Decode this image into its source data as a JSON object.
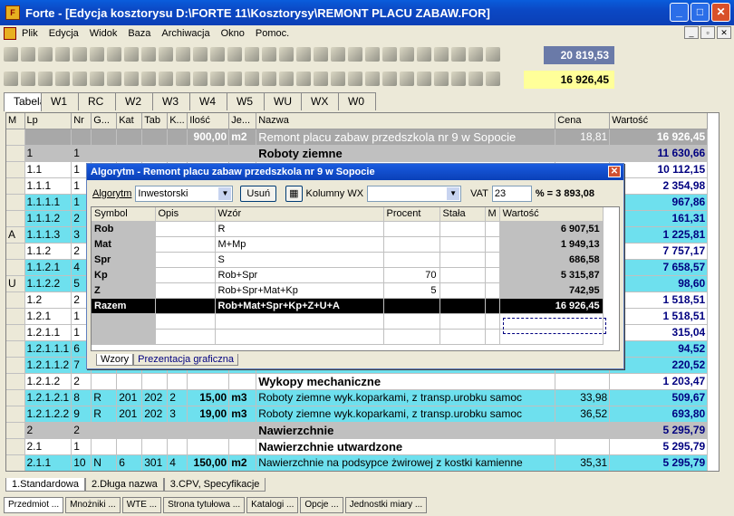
{
  "window": {
    "title": "Forte - [Edycja kosztorysu D:\\FORTE 11\\Kosztorysy\\REMONT PLACU ZABAW.FOR]",
    "menu": [
      "Plik",
      "Edycja",
      "Widok",
      "Baza",
      "Archiwacja",
      "Okno",
      "Pomoc."
    ]
  },
  "toolbar": {
    "value1": "20 819,53",
    "value2": "16 926,45"
  },
  "tabs": [
    "Tabela",
    "W1",
    "RC",
    "W2",
    "W3",
    "W4",
    "W5",
    "WU",
    "WX",
    "W0"
  ],
  "grid": {
    "headers": [
      "M",
      "Lp",
      "Nr",
      "G...",
      "Kat",
      "Tab",
      "K...",
      "Ilość",
      "Je...",
      "Nazwa",
      "Cena",
      "Wartość"
    ],
    "rows": [
      {
        "style": "top",
        "m": "",
        "lp": "",
        "nr": "",
        "g": "",
        "kat": "",
        "tab": "",
        "k": "",
        "ilosc": "900,00",
        "j": "m2",
        "nazwa": "Remont placu zabaw przedszkola nr 9 w Sopocie",
        "cena": "18,81",
        "wartosc": "16 926,45"
      },
      {
        "style": "grey",
        "m": "",
        "lp": "1",
        "nr": "1",
        "g": "",
        "kat": "",
        "tab": "",
        "k": "",
        "ilosc": "",
        "j": "",
        "nazwa": "Roboty ziemne",
        "cena": "",
        "wartosc": "11 630,66"
      },
      {
        "style": "white",
        "m": "",
        "lp": "1.1",
        "nr": "1",
        "g": "",
        "kat": "",
        "tab": "",
        "k": "",
        "ilosc": "",
        "j": "",
        "nazwa": "",
        "cena": "",
        "wartosc": "10 112,15"
      },
      {
        "style": "white",
        "m": "",
        "lp": "1.1.1",
        "nr": "1",
        "g": "",
        "kat": "",
        "tab": "",
        "k": "",
        "ilosc": "",
        "j": "",
        "nazwa": "",
        "cena": "",
        "wartosc": "2 354,98"
      },
      {
        "style": "cyan",
        "m": "",
        "lp": "1.1.1.1",
        "nr": "1",
        "g": "",
        "kat": "",
        "tab": "",
        "k": "",
        "ilosc": "",
        "j": "",
        "nazwa": "",
        "cena": "",
        "wartosc": "967,86"
      },
      {
        "style": "cyan",
        "m": "",
        "lp": "1.1.1.2",
        "nr": "2",
        "g": "",
        "kat": "",
        "tab": "",
        "k": "",
        "ilosc": "",
        "j": "",
        "nazwa": "",
        "cena": "",
        "wartosc": "161,31"
      },
      {
        "style": "cyan",
        "m": "A",
        "lp": "1.1.1.3",
        "nr": "3",
        "g": "",
        "kat": "",
        "tab": "",
        "k": "",
        "ilosc": "",
        "j": "",
        "nazwa": "",
        "cena": "",
        "wartosc": "1 225,81"
      },
      {
        "style": "white",
        "m": "",
        "lp": "1.1.2",
        "nr": "2",
        "g": "",
        "kat": "",
        "tab": "",
        "k": "",
        "ilosc": "",
        "j": "",
        "nazwa": "",
        "cena": "",
        "wartosc": "7 757,17"
      },
      {
        "style": "cyan",
        "m": "",
        "lp": "1.1.2.1",
        "nr": "4",
        "g": "",
        "kat": "",
        "tab": "",
        "k": "",
        "ilosc": "",
        "j": "",
        "nazwa": "",
        "cena": "",
        "wartosc": "7 658,57"
      },
      {
        "style": "cyan",
        "m": "U",
        "lp": "1.1.2.2",
        "nr": "5",
        "g": "",
        "kat": "",
        "tab": "",
        "k": "",
        "ilosc": "",
        "j": "",
        "nazwa": "",
        "cena": "",
        "wartosc": "98,60"
      },
      {
        "style": "white",
        "m": "",
        "lp": "1.2",
        "nr": "2",
        "g": "",
        "kat": "",
        "tab": "",
        "k": "",
        "ilosc": "",
        "j": "",
        "nazwa": "",
        "cena": "",
        "wartosc": "1 518,51"
      },
      {
        "style": "white",
        "m": "",
        "lp": "1.2.1",
        "nr": "1",
        "g": "",
        "kat": "",
        "tab": "",
        "k": "",
        "ilosc": "",
        "j": "",
        "nazwa": "",
        "cena": "",
        "wartosc": "1 518,51"
      },
      {
        "style": "white",
        "m": "",
        "lp": "1.2.1.1",
        "nr": "1",
        "g": "",
        "kat": "",
        "tab": "",
        "k": "",
        "ilosc": "",
        "j": "",
        "nazwa": "",
        "cena": "",
        "wartosc": "315,04"
      },
      {
        "style": "cyan",
        "m": "",
        "lp": "1.2.1.1.1",
        "nr": "6",
        "g": "",
        "kat": "",
        "tab": "",
        "k": "",
        "ilosc": "",
        "j": "",
        "nazwa": "",
        "cena": "",
        "wartosc": "94,52"
      },
      {
        "style": "cyan",
        "m": "",
        "lp": "1.2.1.1.2",
        "nr": "7",
        "g": "",
        "kat": "",
        "tab": "",
        "k": "",
        "ilosc": "",
        "j": "",
        "nazwa": "",
        "cena": "",
        "wartosc": "220,52"
      },
      {
        "style": "white",
        "m": "",
        "lp": "1.2.1.2",
        "nr": "2",
        "g": "",
        "kat": "",
        "tab": "",
        "k": "",
        "ilosc": "",
        "j": "",
        "nazwa": "Wykopy mechaniczne",
        "cena": "",
        "wartosc": "1 203,47"
      },
      {
        "style": "cyan",
        "m": "",
        "lp": "1.2.1.2.1",
        "nr": "8",
        "g": "R",
        "kat": "201",
        "tab": "202",
        "k": "2",
        "ilosc": "15,00",
        "j": "m3",
        "nazwa": "Roboty ziemne wyk.koparkami, z transp.urobku samoc",
        "cena": "33,98",
        "wartosc": "509,67"
      },
      {
        "style": "cyan",
        "m": "",
        "lp": "1.2.1.2.2",
        "nr": "9",
        "g": "R",
        "kat": "201",
        "tab": "202",
        "k": "3",
        "ilosc": "19,00",
        "j": "m3",
        "nazwa": "Roboty ziemne wyk.koparkami, z transp.urobku samoc",
        "cena": "36,52",
        "wartosc": "693,80"
      },
      {
        "style": "grey",
        "m": "",
        "lp": "2",
        "nr": "2",
        "g": "",
        "kat": "",
        "tab": "",
        "k": "",
        "ilosc": "",
        "j": "",
        "nazwa": "Nawierzchnie",
        "cena": "",
        "wartosc": "5 295,79"
      },
      {
        "style": "white",
        "m": "",
        "lp": "2.1",
        "nr": "1",
        "g": "",
        "kat": "",
        "tab": "",
        "k": "",
        "ilosc": "",
        "j": "",
        "nazwa": "Nawierzchnie utwardzone",
        "cena": "",
        "wartosc": "5 295,79"
      },
      {
        "style": "cyan",
        "m": "",
        "lp": "2.1.1",
        "nr": "10",
        "g": "N",
        "kat": "6",
        "tab": "301",
        "k": "4",
        "ilosc": "150,00",
        "j": "m2",
        "nazwa": "Nawierzchnie na podsypce żwirowej z kostki kamienne",
        "cena": "35,31",
        "wartosc": "5 295,79"
      }
    ]
  },
  "dialog": {
    "title": "Algorytm - Remont placu zabaw przedszkola nr 9 w Sopocie",
    "algorytm_label": "Algorytm",
    "algorytm_value": "Inwestorski",
    "usun_label": "Usuń",
    "kolumny_label": "Kolumny WX",
    "vat_label": "VAT",
    "vat_value": "23",
    "vat_result": "% = 3 893,08",
    "headers": [
      "Symbol",
      "Opis",
      "Wzór",
      "Procent",
      "Stała",
      "M",
      "Wartość"
    ],
    "rows": [
      {
        "symbol": "Rob",
        "wzor": "R",
        "procent": "",
        "wartosc": "6 907,51"
      },
      {
        "symbol": "Mat",
        "wzor": "M+Mp",
        "procent": "",
        "wartosc": "1 949,13"
      },
      {
        "symbol": "Spr",
        "wzor": "S",
        "procent": "",
        "wartosc": "686,58"
      },
      {
        "symbol": "Kp",
        "wzor": "Rob+Spr",
        "procent": "70",
        "wartosc": "5 315,87"
      },
      {
        "symbol": "Z",
        "wzor": "Rob+Spr+Mat+Kp",
        "procent": "5",
        "wartosc": "742,95"
      },
      {
        "symbol": "Razem",
        "wzor": "Rob+Mat+Spr+Kp+Z+U+A",
        "procent": "",
        "wartosc": "16 926,45"
      }
    ],
    "tabs": [
      "Wzory",
      "Prezentacja graficzna"
    ]
  },
  "bottom_tabs": [
    "1.Standardowa",
    "2.Długa nazwa",
    "3.CPV, Specyfikacje"
  ],
  "status": [
    "Przedmiot ...",
    "Mnożniki ...",
    "WTE ...",
    "Strona tytułowa ...",
    "Katalogi ...",
    "Opcje ...",
    "Jednostki miary ..."
  ]
}
